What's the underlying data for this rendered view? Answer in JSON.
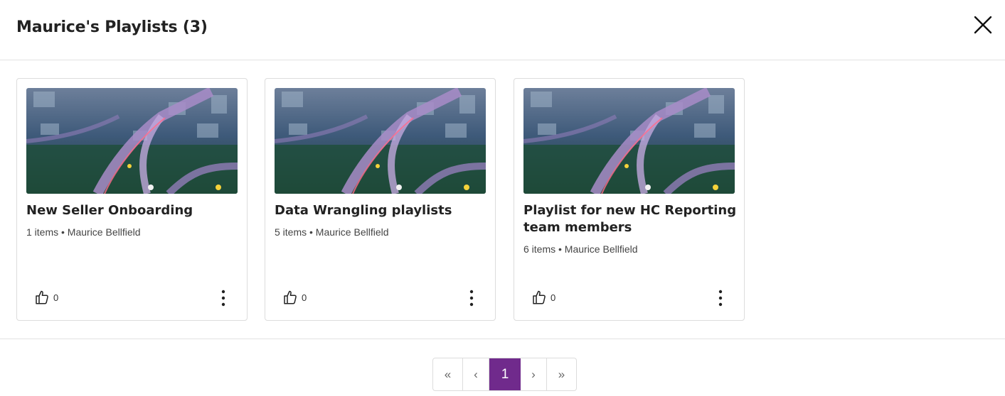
{
  "modal": {
    "title": "Maurice's Playlists (3)"
  },
  "icons": {
    "close": "close-icon",
    "like": "thumbs-up-icon",
    "more": "more-vertical-icon"
  },
  "playlists": [
    {
      "title": "New Seller Onboarding",
      "meta": "1 items • Maurice Bellfield",
      "likes": "0"
    },
    {
      "title": "Data Wrangling playlists",
      "meta": "5 items • Maurice Bellfield",
      "likes": "0"
    },
    {
      "title": "Playlist for new HC Reporting team members",
      "meta": "6 items • Maurice Bellfield",
      "likes": "0"
    }
  ],
  "pagination": {
    "first": "«",
    "prev": "‹",
    "current": "1",
    "next": "›",
    "last": "»",
    "active_color": "#702a8c"
  }
}
